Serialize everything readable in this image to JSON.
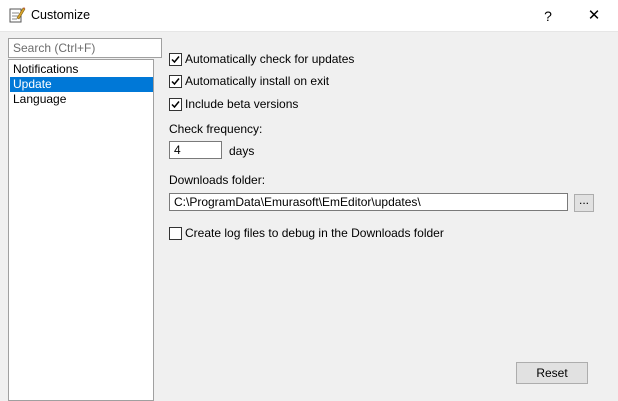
{
  "window": {
    "title": "Customize",
    "help_label": "?",
    "close_label": "✕",
    "icon": "notepad-pencil-icon"
  },
  "sidebar": {
    "search_placeholder": "Search (Ctrl+F)",
    "items": [
      {
        "label": "Notifications",
        "selected": false
      },
      {
        "label": "Update",
        "selected": true
      },
      {
        "label": "Language",
        "selected": false
      }
    ]
  },
  "options": {
    "auto_check": {
      "label": "Automatically check for updates",
      "checked": true
    },
    "auto_install": {
      "label": "Automatically install on exit",
      "checked": true
    },
    "beta": {
      "label": "Include beta versions",
      "checked": true
    },
    "check_frequency_label": "Check frequency:",
    "check_frequency_value": "4",
    "check_frequency_unit": "days",
    "downloads_folder_label": "Downloads folder:",
    "downloads_folder_value": "C:\\ProgramData\\Emurasoft\\EmEditor\\updates\\",
    "browse_label": "...",
    "log_files": {
      "label": "Create log files to debug in the Downloads folder",
      "checked": false
    }
  },
  "footer": {
    "reset_label": "Reset"
  },
  "colors": {
    "selection": "#0078d7",
    "dialog_background": "#f0f0f0"
  }
}
